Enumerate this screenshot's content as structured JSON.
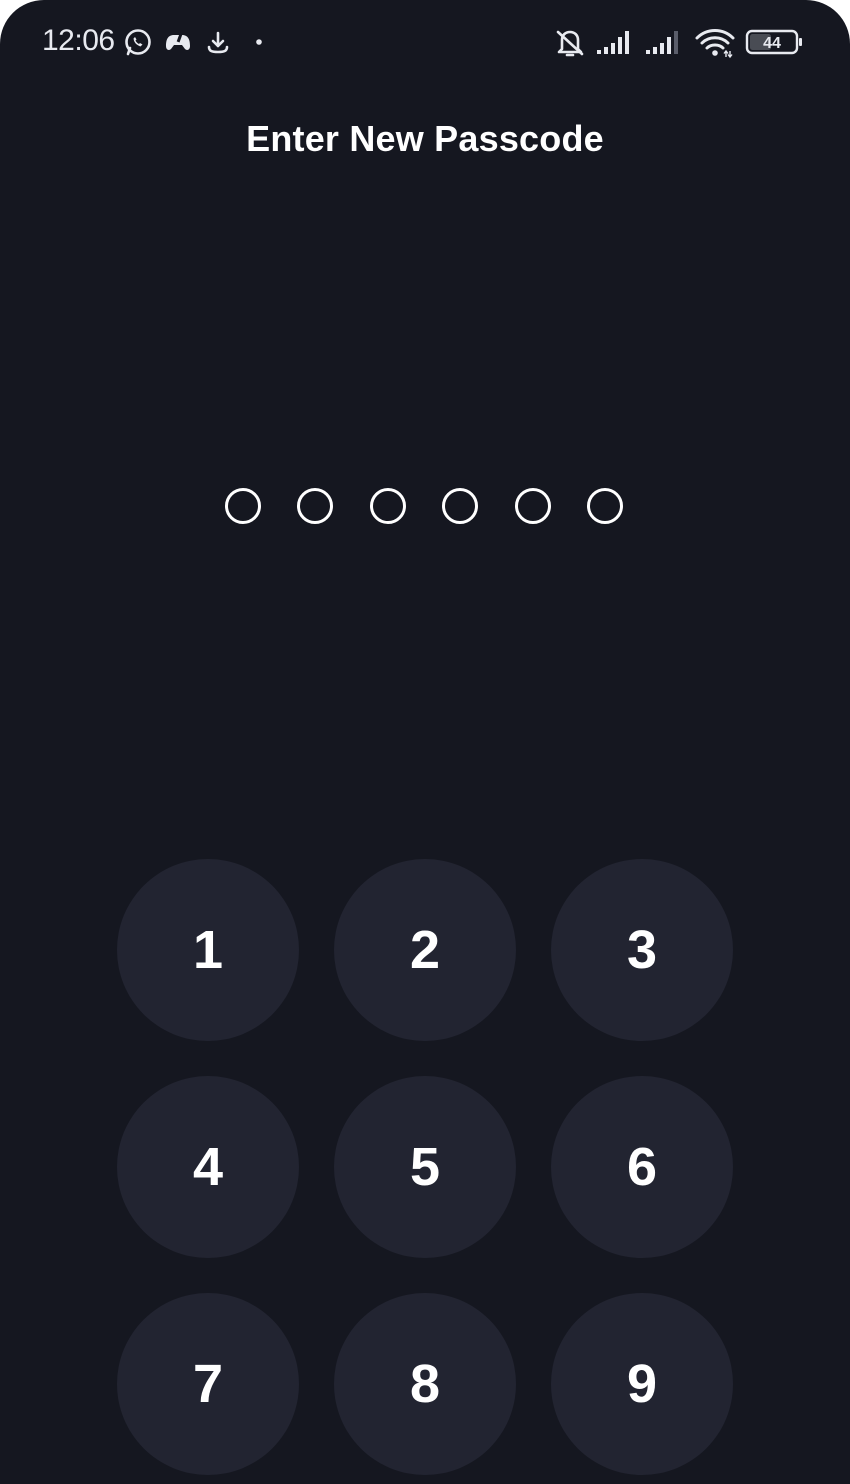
{
  "status_bar": {
    "time": "12:06",
    "battery_level": "44",
    "icons": [
      "whatsapp-icon",
      "gamepad-icon",
      "download-icon",
      "notification-dot-icon",
      "bell-muted-icon",
      "signal-icon",
      "signal-icon",
      "wifi-icon",
      "battery-icon"
    ]
  },
  "screen": {
    "title": "Enter New Passcode",
    "passcode_length": 6,
    "digits_entered": 0
  },
  "keypad": {
    "keys": [
      "1",
      "2",
      "3",
      "4",
      "5",
      "6",
      "7",
      "8",
      "9"
    ]
  },
  "colors": {
    "background": "#151720",
    "key_background": "#222431",
    "text": "#ffffff"
  }
}
